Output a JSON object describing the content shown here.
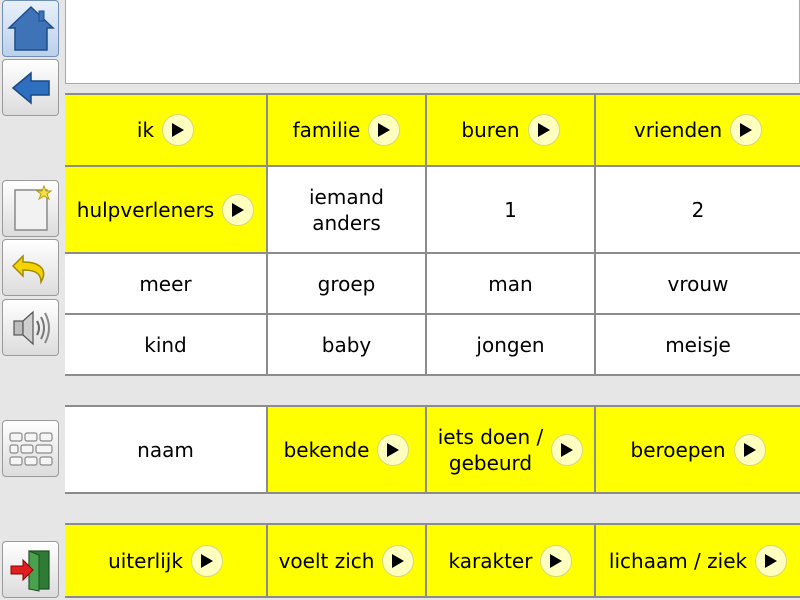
{
  "toolbar": {
    "buttons": [
      {
        "name": "home-button",
        "icon": "home-icon"
      },
      {
        "name": "back-button",
        "icon": "back-arrow-icon"
      },
      {
        "name": "new-page-button",
        "icon": "new-page-icon"
      },
      {
        "name": "undo-button",
        "icon": "undo-icon"
      },
      {
        "name": "speak-button",
        "icon": "speaker-icon"
      },
      {
        "name": "keyboard-button",
        "icon": "keyboard-icon"
      },
      {
        "name": "exit-button",
        "icon": "exit-door-icon"
      }
    ]
  },
  "message_box": {
    "text": ""
  },
  "grid": {
    "row1": [
      {
        "label": "ik",
        "has_arrow": true,
        "color": "yellow"
      },
      {
        "label": "familie",
        "has_arrow": true,
        "color": "yellow"
      },
      {
        "label": "buren",
        "has_arrow": true,
        "color": "yellow"
      },
      {
        "label": "vrienden",
        "has_arrow": true,
        "color": "yellow"
      }
    ],
    "row2": [
      {
        "label": "hulpverleners",
        "has_arrow": true,
        "color": "yellow"
      },
      {
        "label": "iemand\nanders",
        "has_arrow": false,
        "color": "white"
      },
      {
        "label": "1",
        "has_arrow": false,
        "color": "white"
      },
      {
        "label": "2",
        "has_arrow": false,
        "color": "white"
      }
    ],
    "row3": [
      {
        "label": "meer",
        "has_arrow": false,
        "color": "white"
      },
      {
        "label": "groep",
        "has_arrow": false,
        "color": "white"
      },
      {
        "label": "man",
        "has_arrow": false,
        "color": "white"
      },
      {
        "label": "vrouw",
        "has_arrow": false,
        "color": "white"
      }
    ],
    "row4": [
      {
        "label": "kind",
        "has_arrow": false,
        "color": "white"
      },
      {
        "label": "baby",
        "has_arrow": false,
        "color": "white"
      },
      {
        "label": "jongen",
        "has_arrow": false,
        "color": "white"
      },
      {
        "label": "meisje",
        "has_arrow": false,
        "color": "white"
      }
    ],
    "row5": [
      {
        "label": "naam",
        "has_arrow": false,
        "color": "white"
      },
      {
        "label": "bekende",
        "has_arrow": true,
        "color": "yellow"
      },
      {
        "label": "iets doen /\ngebeurd",
        "has_arrow": true,
        "color": "yellow"
      },
      {
        "label": "beroepen",
        "has_arrow": true,
        "color": "yellow"
      }
    ],
    "row6": [
      {
        "label": "uiterlijk",
        "has_arrow": true,
        "color": "yellow"
      },
      {
        "label": "voelt zich",
        "has_arrow": true,
        "color": "yellow"
      },
      {
        "label": "karakter",
        "has_arrow": true,
        "color": "yellow"
      },
      {
        "label": "lichaam / ziek",
        "has_arrow": true,
        "color": "yellow"
      }
    ]
  },
  "colors": {
    "cell_yellow": "#ffff00",
    "cell_white": "#ffffff",
    "background": "#e6e6e6"
  }
}
